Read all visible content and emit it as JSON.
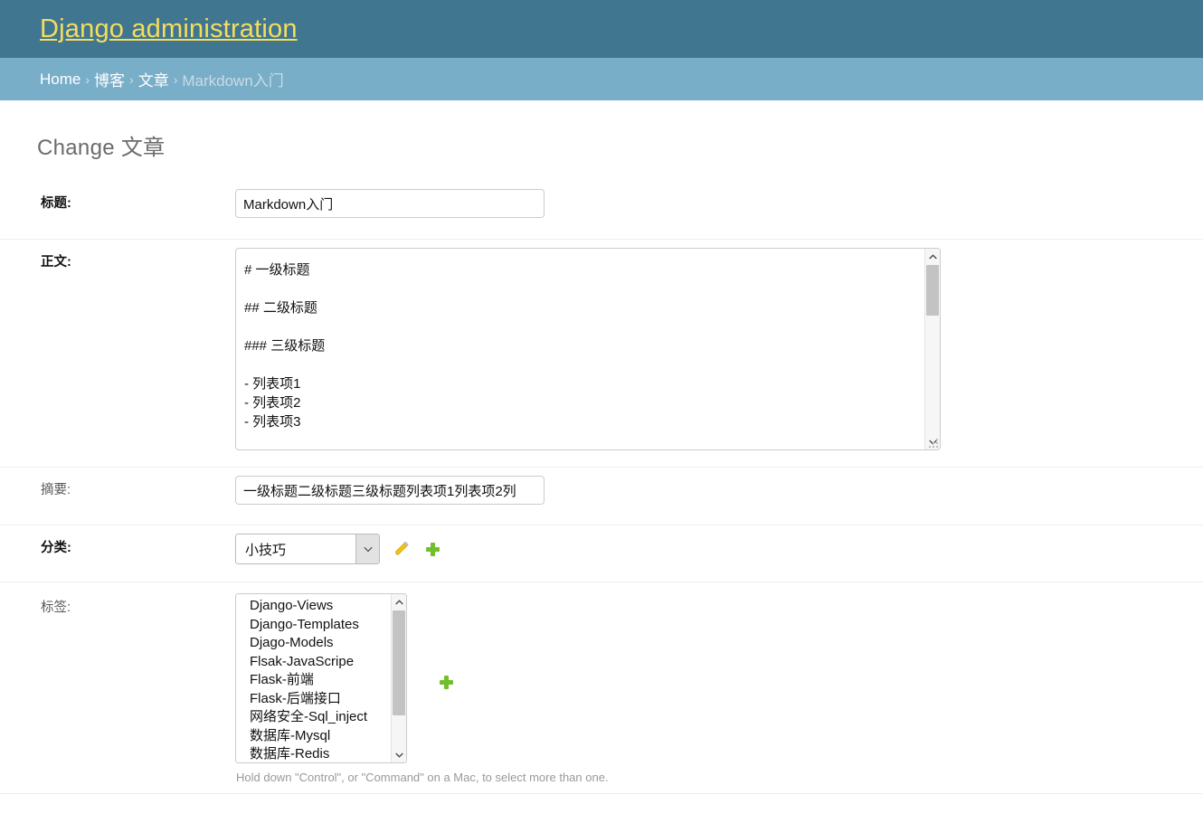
{
  "header": {
    "site_name": "Django administration",
    "site_name_color": "#f5dd5d",
    "background_color": "#417690"
  },
  "breadcrumbs": {
    "background_color": "#79aec8",
    "separator": "›",
    "items": [
      {
        "label": "Home",
        "current": false
      },
      {
        "label": "博客",
        "current": false
      },
      {
        "label": "文章",
        "current": false
      },
      {
        "label": "Markdown入门",
        "current": true
      }
    ]
  },
  "page": {
    "title": "Change 文章"
  },
  "form": {
    "title_field": {
      "label": "标题:",
      "value": "Markdown入门",
      "required": true
    },
    "body_field": {
      "label": "正文:",
      "required": true,
      "value": "# 一级标题\n\n## 二级标题\n\n### 三级标题\n\n- 列表项1\n- 列表项2\n- 列表项3"
    },
    "summary_field": {
      "label": "摘要:",
      "value": "一级标题二级标题三级标题列表项1列表项2列",
      "required": false
    },
    "category_field": {
      "label": "分类:",
      "selected": "小技巧",
      "required": true,
      "edit_icon": "pencil-icon",
      "add_icon": "plus-icon",
      "add_icon_color": "#70bf2b",
      "edit_icon_color": "#efb80b"
    },
    "tags_field": {
      "label": "标签:",
      "required": false,
      "options": [
        "Django-Views",
        "Django-Templates",
        "Djago-Models",
        "Flsak-JavaScripe",
        "Flask-前端",
        "Flask-后端接口",
        "网络安全-Sql_inject",
        "数据库-Mysql",
        "数据库-Redis"
      ],
      "add_icon": "plus-icon",
      "help_text": "Hold down \"Control\", or \"Command\" on a Mac, to select more than one."
    }
  },
  "icons": {
    "chevron_up": "⌃",
    "chevron_down": "⌄"
  }
}
